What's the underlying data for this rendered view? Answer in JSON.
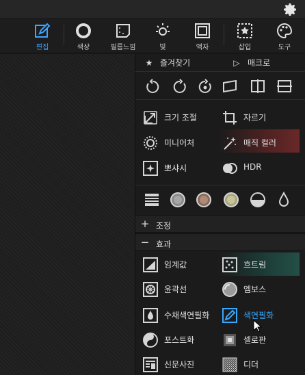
{
  "colors": {
    "accent": "#3fa4ff",
    "panel_bg": "#1b1b1b",
    "icon": "#d6d6d6"
  },
  "toolbar": {
    "tools": [
      {
        "label": "편집",
        "icon": "edit-icon",
        "active": true
      },
      {
        "label": "색상",
        "icon": "color-circle-icon"
      },
      {
        "label": "필름느낌",
        "icon": "film-icon"
      },
      {
        "label": "빛",
        "icon": "sun-icon"
      },
      {
        "label": "액자",
        "icon": "frame-icon"
      },
      {
        "label": "삽입",
        "icon": "insert-star-icon"
      },
      {
        "label": "도구",
        "icon": "palette-icon"
      }
    ]
  },
  "panel": {
    "favorites_label": "즐겨찾기",
    "macro_label": "매크로",
    "tools_row1": {
      "resize": "크기 조절",
      "crop": "자르기"
    },
    "tools_row2": {
      "miniature": "미니어처",
      "magic_color": "매직 컬러"
    },
    "tools_row3": {
      "sharpen": "뽀샤시",
      "hdr": "HDR"
    },
    "adjust_section": "조정",
    "effect_section": "효과",
    "effects": {
      "threshold": "임계값",
      "scatter": "흐트림",
      "outline": "윤곽선",
      "emboss": "엠보스",
      "watercolor": "수채색연필화",
      "color_pencil": "색연필화",
      "posterize": "포스트화",
      "celluloid": "셀로판",
      "newspaper": "신문사진",
      "dither": "디더"
    }
  }
}
